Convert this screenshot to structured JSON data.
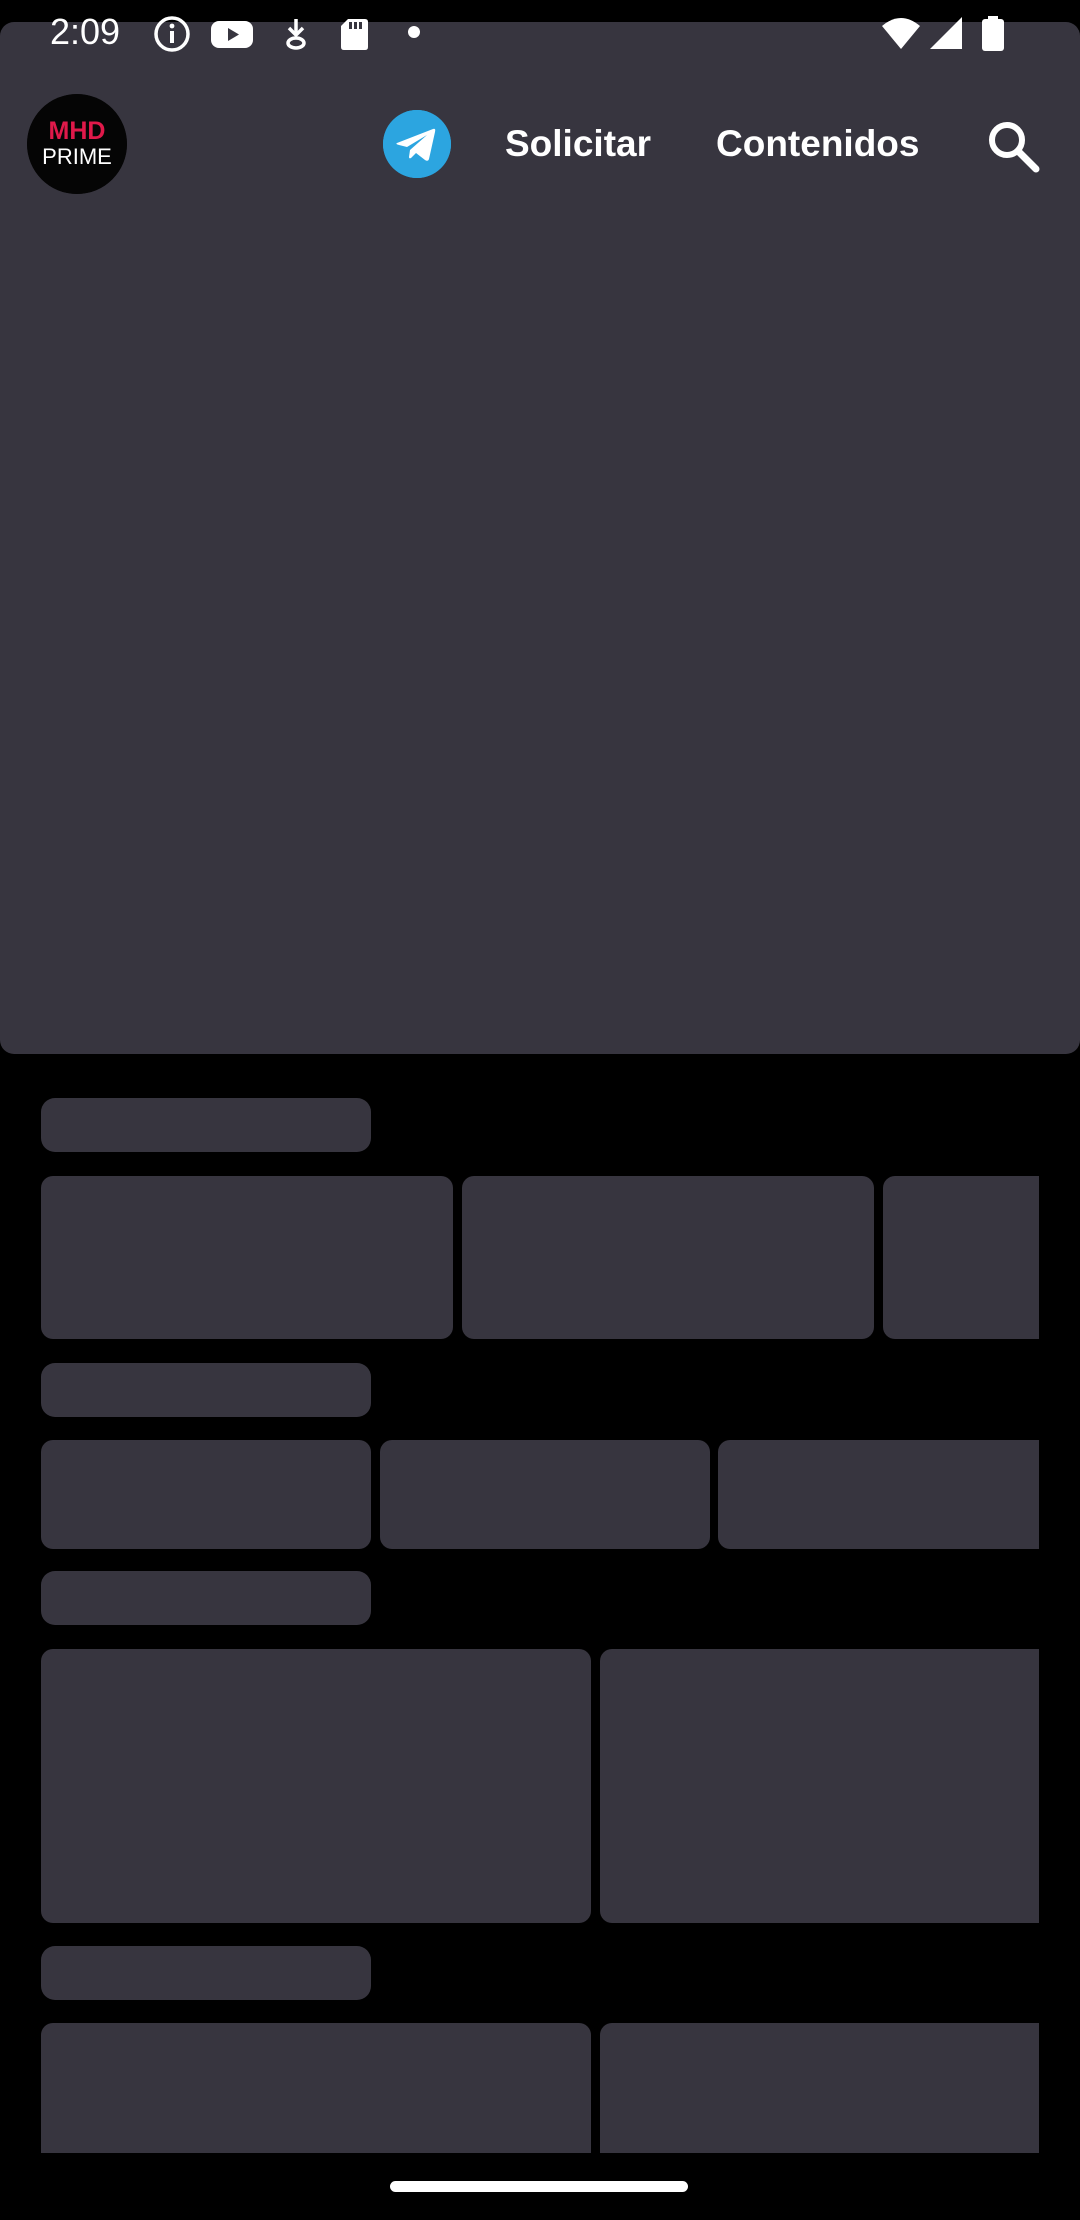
{
  "status_bar": {
    "time": "2:09",
    "icons": [
      "info-icon",
      "youtube-icon",
      "download-icon",
      "sd-card-icon",
      "dot-icon",
      "wifi-icon",
      "signal-icon",
      "battery-icon"
    ]
  },
  "app_bar": {
    "logo": {
      "line1": "MHD",
      "line2": "PRIME",
      "accent_color": "#e0194a"
    },
    "telegram_icon": "telegram-icon",
    "telegram_color": "#2ca5e0",
    "nav_solicitar": "Solicitar",
    "nav_contenidos": "Contenidos",
    "search_icon": "search-icon"
  },
  "colors": {
    "background": "#000000",
    "skeleton": "#37353f",
    "text": "#ffffff"
  },
  "sections": [
    {
      "state": "loading",
      "placeholder_cards": 3
    },
    {
      "state": "loading",
      "placeholder_cards": 3
    },
    {
      "state": "loading",
      "placeholder_cards": 2
    },
    {
      "state": "loading",
      "placeholder_cards": 2
    }
  ]
}
